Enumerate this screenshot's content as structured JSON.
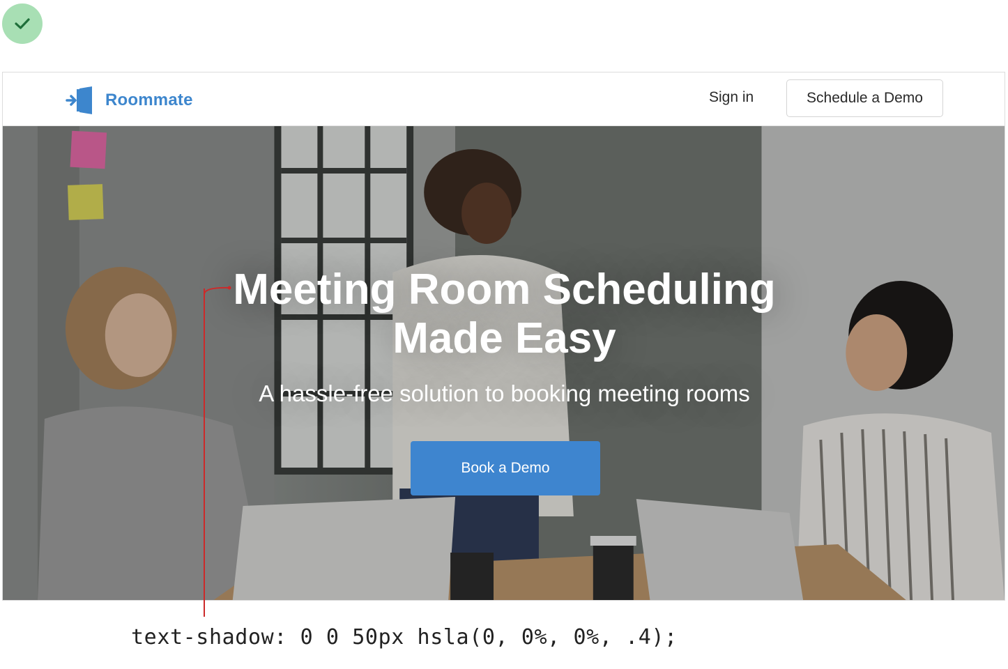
{
  "status": {
    "icon": "check-icon"
  },
  "navbar": {
    "brand_name": "Roommate",
    "brand_icon": "door-enter-icon",
    "sign_in_label": "Sign in",
    "schedule_label": "Schedule a Demo"
  },
  "hero": {
    "title_line1": "Meeting Room Scheduling",
    "title_line2": "Made Easy",
    "subtitle": "A hassle-free solution to booking meeting rooms",
    "cta_label": "Book a Demo"
  },
  "annotation": {
    "code": "text-shadow: 0 0 50px hsla(0, 0%, 0%, .4);",
    "line_color": "#cc2a2a"
  },
  "colors": {
    "brand": "#3d86cd",
    "cta": "#3e85cf",
    "check_badge": "#a8dfb4"
  }
}
